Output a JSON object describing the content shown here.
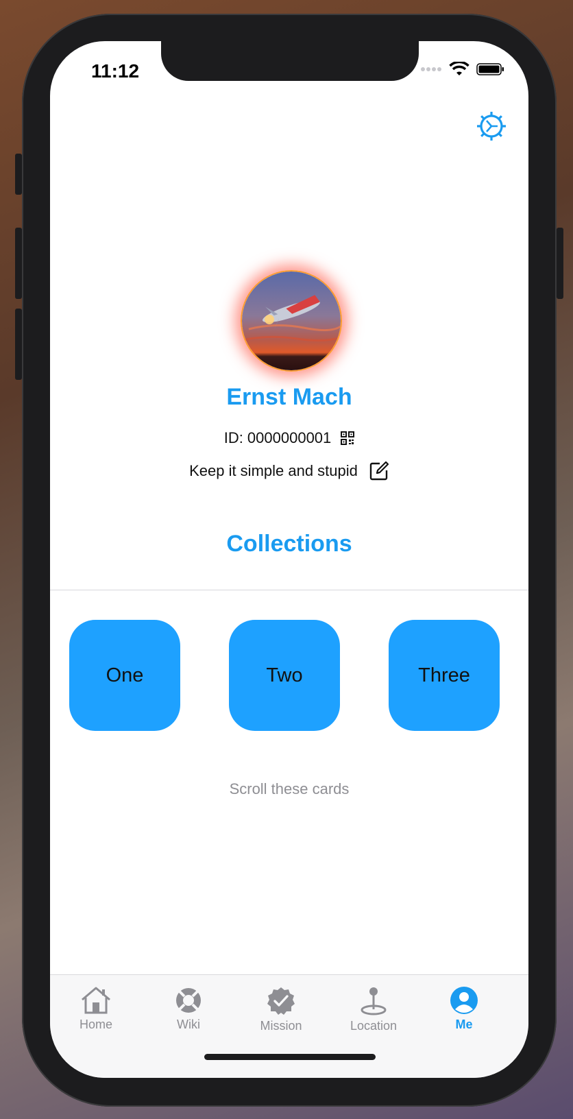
{
  "status_bar": {
    "time": "11:12"
  },
  "profile": {
    "name": "Ernst Mach",
    "id_text": "ID: 0000000001",
    "bio": "Keep it simple and stupid"
  },
  "collections": {
    "title": "Collections",
    "cards": [
      "One",
      "Two",
      "Three"
    ],
    "hint": "Scroll these cards"
  },
  "tabbar": {
    "tabs": [
      {
        "label": "Home",
        "icon": "home-icon"
      },
      {
        "label": "Wiki",
        "icon": "lifebuoy-icon"
      },
      {
        "label": "Mission",
        "icon": "checkmark-seal-icon"
      },
      {
        "label": "Location",
        "icon": "location-pin-icon"
      },
      {
        "label": "Me",
        "icon": "person-circle-icon"
      }
    ],
    "active": "Me"
  },
  "colors": {
    "accent": "#1a9bf0",
    "card": "#1ea1ff",
    "inactive": "#8e8e93"
  }
}
